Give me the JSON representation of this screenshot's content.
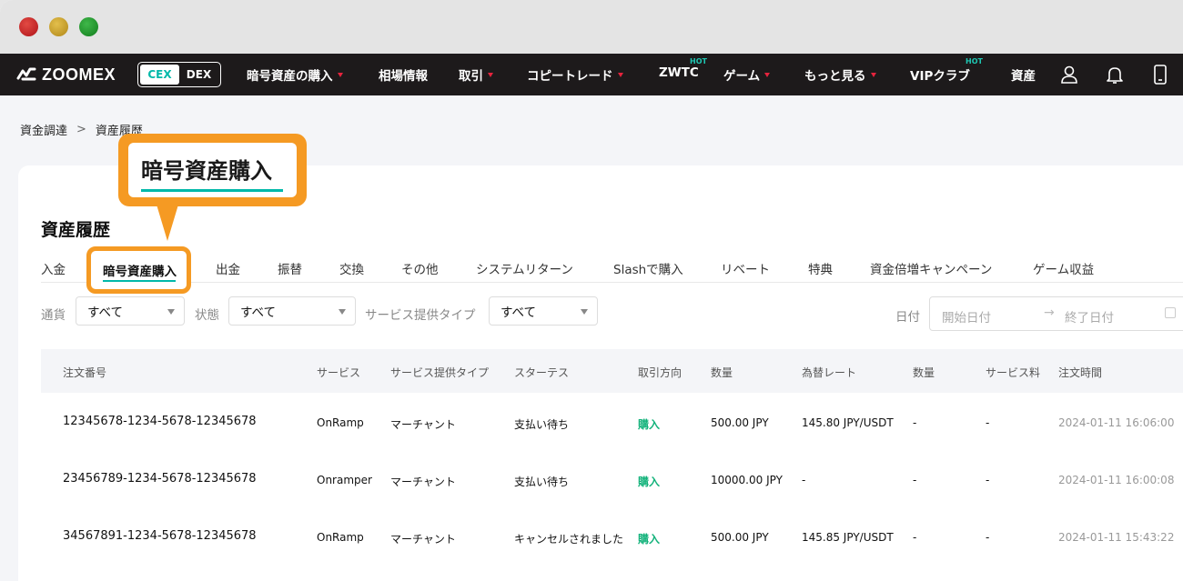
{
  "nav": {
    "logo": "ZOOMEX",
    "cex": "CEX",
    "dex": "DEX",
    "items": [
      {
        "label": "暗号資産の購入"
      },
      {
        "label": "相場情報"
      },
      {
        "label": "取引"
      },
      {
        "label": "コピートレード"
      },
      {
        "label": "ZWTC",
        "badge": "HOT"
      },
      {
        "label": "ゲーム"
      },
      {
        "label": "もっと見る"
      },
      {
        "label": "VIPクラブ",
        "badge": "HOT"
      },
      {
        "label": "資産"
      }
    ],
    "icons": [
      "user-icon",
      "bell-icon",
      "mobile-icon"
    ]
  },
  "breadcrumb": {
    "parent": "資金調達",
    "sep": ">",
    "current": "資産履歴"
  },
  "callout": {
    "label": "暗号資産購入"
  },
  "page_title": "資産履歴",
  "tabs": [
    "入金",
    "暗号資産購入",
    "出金",
    "振替",
    "交換",
    "その他",
    "システムリターン",
    "Slashで購入",
    "リベート",
    "特典",
    "資金倍増キャンペーン",
    "ゲーム収益"
  ],
  "active_tab": "暗号資産購入",
  "filters": {
    "currency_label": "通貨",
    "currency_value": "すべて",
    "status_label": "状態",
    "status_value": "すべて",
    "service_type_label": "サービス提供タイプ",
    "service_type_value": "すべて",
    "date_label": "日付",
    "start_placeholder": "開始日付",
    "end_placeholder": "終了日付"
  },
  "table": {
    "headers": [
      "注文番号",
      "サービス",
      "サービス提供タイプ",
      "スターテス",
      "取引方向",
      "数量",
      "為替レート",
      "数量",
      "サービス料",
      "注文時間"
    ],
    "rows": [
      [
        "12345678-1234-5678-12345678",
        "OnRamp",
        "マーチャント",
        "支払い待ち",
        "購入",
        "500.00 JPY",
        "145.80 JPY/USDT",
        "-",
        "-",
        "2024-01-11 16:06:00"
      ],
      [
        "23456789-1234-5678-12345678",
        "Onramper",
        "マーチャント",
        "支払い待ち",
        "購入",
        "10000.00 JPY",
        "-",
        "-",
        "-",
        "2024-01-11 16:00:08"
      ],
      [
        "34567891-1234-5678-12345678",
        "OnRamp",
        "マーチャント",
        "キャンセルされました",
        "購入",
        "500.00 JPY",
        "145.85 JPY/USDT",
        "-",
        "-",
        "2024-01-11 15:43:22"
      ]
    ]
  },
  "colors": {
    "accent": "#00b8a9",
    "callout": "#f59a23",
    "buy": "#12b27a",
    "nav_bg": "#1d1a1b",
    "caret": "#e5233d"
  }
}
